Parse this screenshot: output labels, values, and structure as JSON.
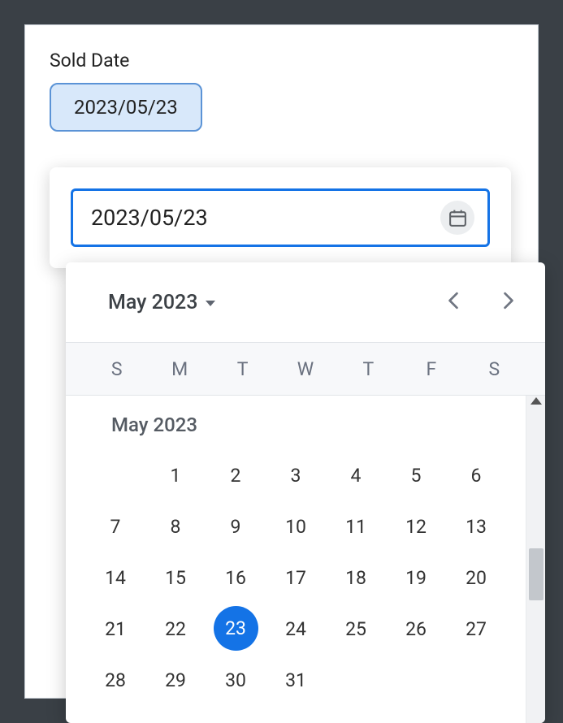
{
  "field": {
    "label": "Sold Date",
    "chip_value": "2023/05/23"
  },
  "input": {
    "value": "2023/05/23"
  },
  "calendar": {
    "header_month": "May 2023",
    "weekdays": [
      "S",
      "M",
      "T",
      "W",
      "T",
      "F",
      "S"
    ],
    "month_label": "May 2023",
    "selected_day": 23,
    "leading_blanks": 1,
    "days_in_month": 31
  },
  "colors": {
    "accent": "#1473e6",
    "chip_bg": "#d8e8fa",
    "chip_border": "#5b93d6"
  }
}
